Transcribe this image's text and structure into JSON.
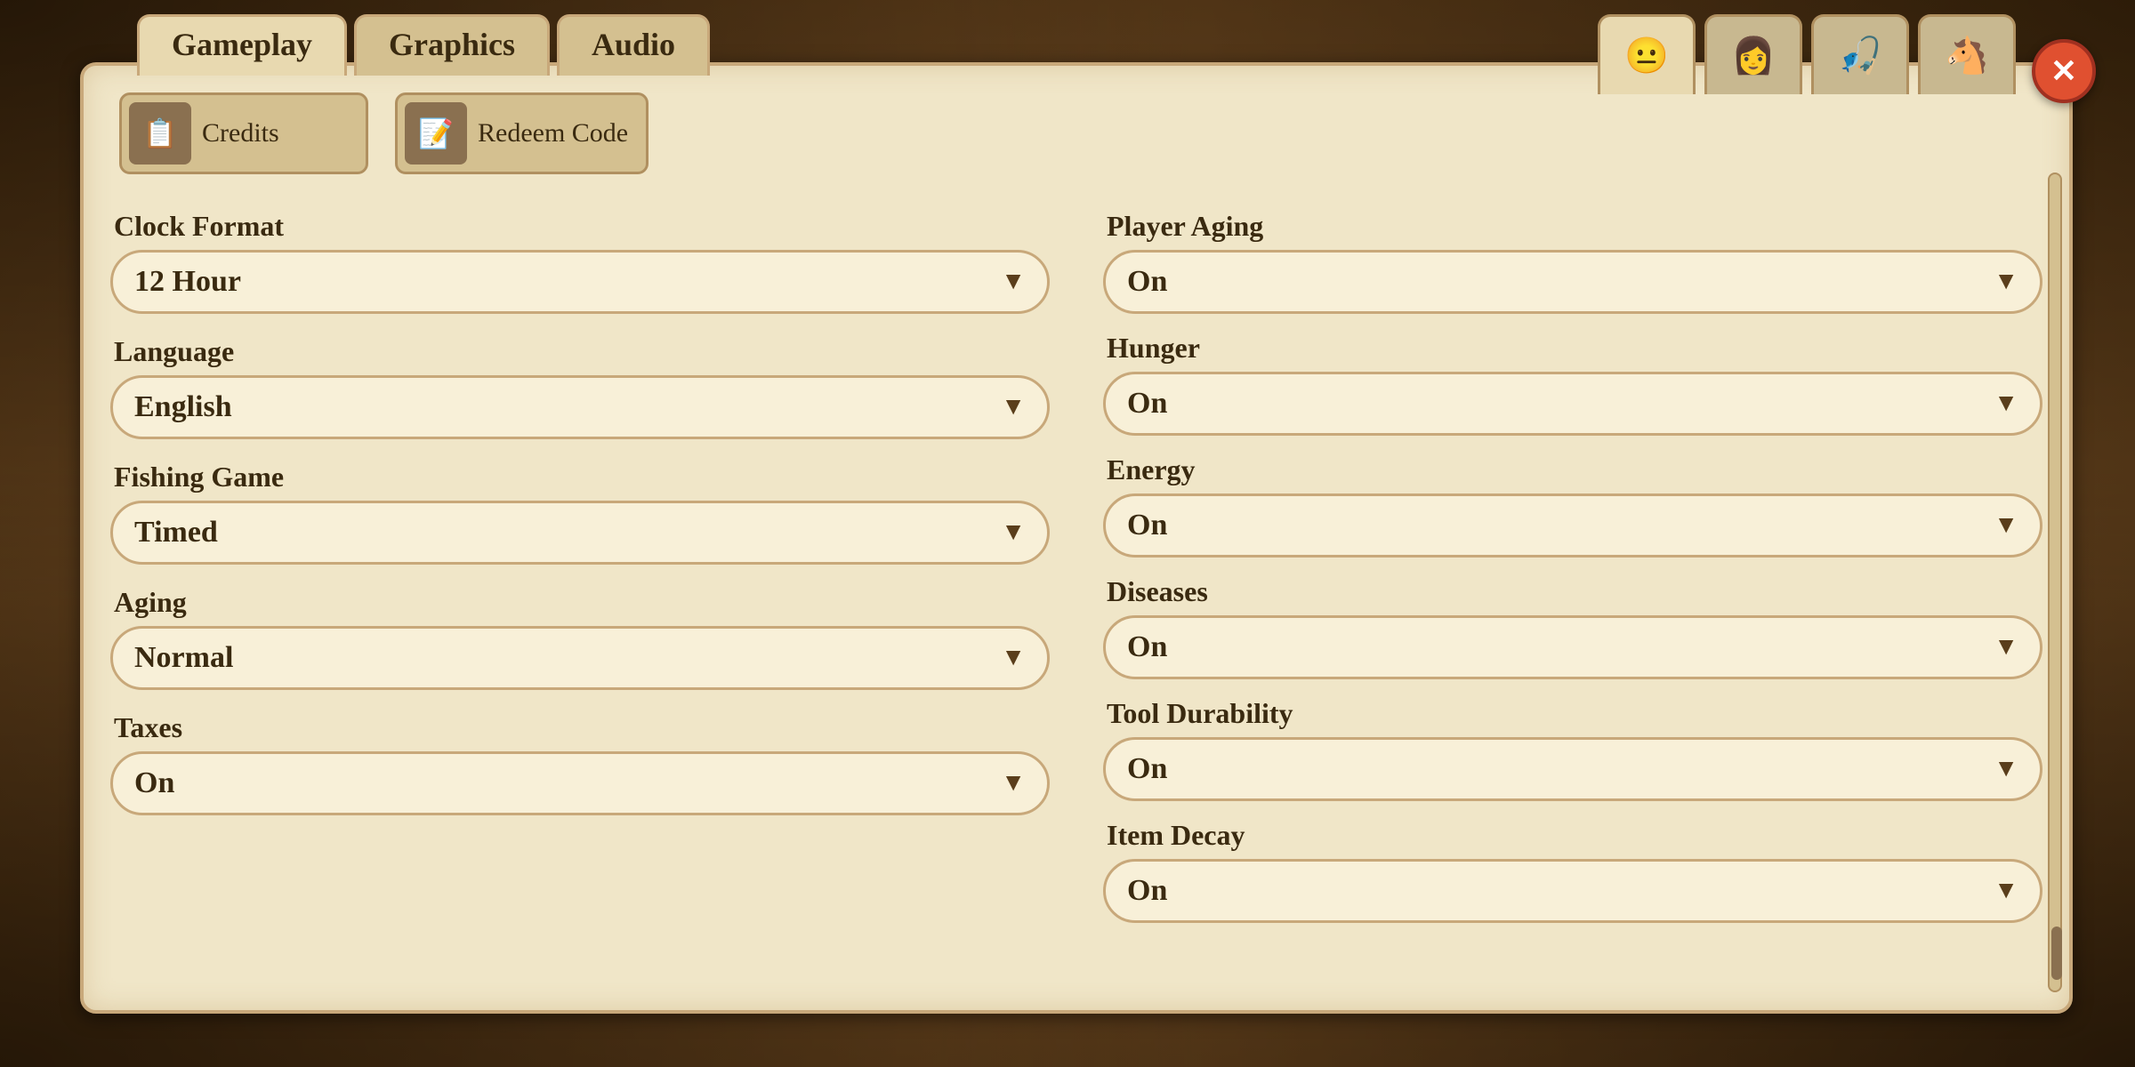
{
  "tabs": {
    "gameplay": "Gameplay",
    "graphics": "Graphics",
    "audio": "Audio"
  },
  "buttons": {
    "credits": "Credits",
    "redeem_code": "Redeem Code"
  },
  "close_icon": "✕",
  "left_settings": [
    {
      "label": "Clock Format",
      "value": "12 Hour"
    },
    {
      "label": "Language",
      "value": "English"
    },
    {
      "label": "Fishing Game",
      "value": "Timed"
    },
    {
      "label": "Aging",
      "value": "Normal"
    },
    {
      "label": "Taxes",
      "value": "On"
    }
  ],
  "right_settings": [
    {
      "label": "Player Aging",
      "value": "On"
    },
    {
      "label": "Hunger",
      "value": "On"
    },
    {
      "label": "Energy",
      "value": "On"
    },
    {
      "label": "Diseases",
      "value": "On"
    },
    {
      "label": "Tool Durability",
      "value": "On"
    },
    {
      "label": "Item Decay",
      "value": "On"
    }
  ],
  "char_icons": [
    "😐",
    "👩",
    "🎣",
    "🐴"
  ],
  "dropdown_arrow": "▼"
}
